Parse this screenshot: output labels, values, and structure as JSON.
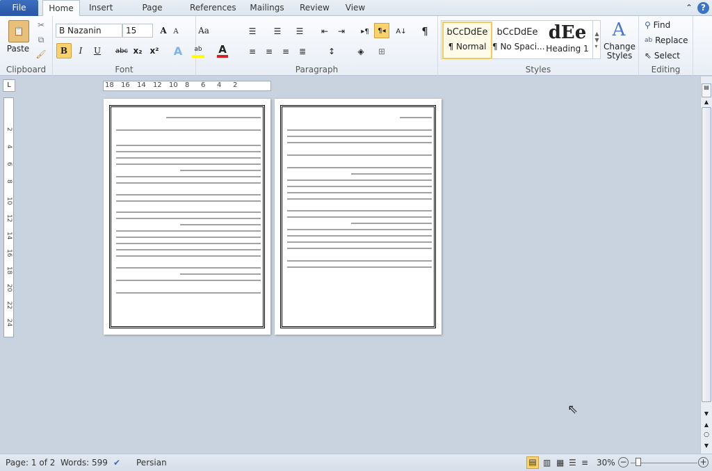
{
  "tabs": [
    "File",
    "Home",
    "Insert",
    "Page Layout",
    "References",
    "Mailings",
    "Review",
    "View"
  ],
  "clipboard": {
    "label": "Clipboard",
    "paste": "Paste"
  },
  "font": {
    "label": "Font",
    "name": "B Nazanin",
    "size": "15",
    "bold": "B",
    "italic": "I",
    "underline": "U",
    "strike": "abc",
    "sub": "x₂",
    "sup": "x²",
    "case": "Aa"
  },
  "paragraph": {
    "label": "Paragraph"
  },
  "styles": {
    "label": "Styles",
    "items": [
      {
        "preview": "bCcDdEe",
        "name": "¶ Normal"
      },
      {
        "preview": "bCcDdEe",
        "name": "¶ No Spaci..."
      },
      {
        "preview": "dEe",
        "name": "Heading 1"
      }
    ],
    "change": "Change Styles"
  },
  "editing": {
    "label": "Editing",
    "find": "Find",
    "replace": "Replace",
    "select": "Select"
  },
  "ruler": {
    "h": [
      "18",
      "16",
      "14",
      "12",
      "10",
      "8",
      "6",
      "4",
      "2"
    ],
    "v": [
      "2",
      "4",
      "6",
      "8",
      "10",
      "12",
      "14",
      "16",
      "18",
      "20",
      "22",
      "24"
    ]
  },
  "status": {
    "page": "Page: 1 of 2",
    "words": "Words: 599",
    "language": "Persian",
    "zoom": "30%"
  },
  "colors": {
    "accent": "#2a56a6",
    "highlight": "#f9d36a",
    "background": "#c9d2df"
  }
}
